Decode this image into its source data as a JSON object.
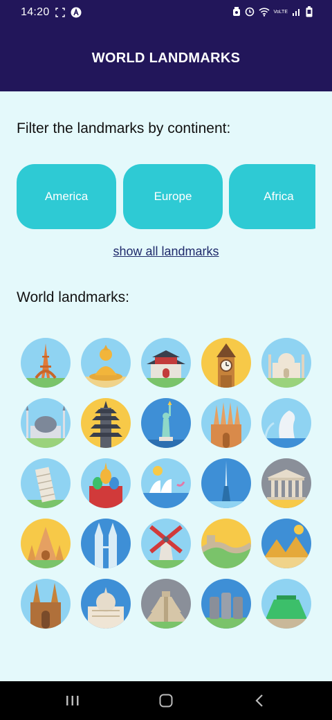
{
  "status_bar": {
    "time": "14:20",
    "left_icons": [
      "screenshot-icon",
      "app-notification-icon"
    ],
    "right_icons": [
      "alarm-icon",
      "clock-icon",
      "wifi-icon",
      "volte-icon",
      "signal-icon",
      "battery-icon"
    ],
    "network_label": "VoLTE"
  },
  "app_bar": {
    "title": "WORLD LANDMARKS"
  },
  "filter": {
    "heading": "Filter the landmarks by continent:",
    "chips": [
      {
        "label": "America"
      },
      {
        "label": "Europe"
      },
      {
        "label": "Africa"
      }
    ],
    "show_all_label": "show all landmarks"
  },
  "landmarks": {
    "heading": "World landmarks:",
    "items": [
      {
        "icon": "eiffel-tower-icon",
        "bg": "#8fd3f2"
      },
      {
        "icon": "buddha-statue-icon",
        "bg": "#8fd3f2"
      },
      {
        "icon": "chinese-gate-icon",
        "bg": "#8fd3f2"
      },
      {
        "icon": "big-ben-icon",
        "bg": "#f7c948"
      },
      {
        "icon": "taj-mahal-icon",
        "bg": "#8fd3f2"
      },
      {
        "icon": "blue-mosque-icon",
        "bg": "#8fd3f2"
      },
      {
        "icon": "pagoda-temple-icon",
        "bg": "#f7c948"
      },
      {
        "icon": "statue-of-liberty-icon",
        "bg": "#3e8fd6"
      },
      {
        "icon": "sagrada-familia-icon",
        "bg": "#8fd3f2"
      },
      {
        "icon": "merlion-icon",
        "bg": "#8fd3f2"
      },
      {
        "icon": "leaning-tower-pisa-icon",
        "bg": "#8fd3f2"
      },
      {
        "icon": "st-basils-cathedral-icon",
        "bg": "#8fd3f2"
      },
      {
        "icon": "sydney-opera-house-icon",
        "bg": "#8fd3f2"
      },
      {
        "icon": "burj-khalifa-icon",
        "bg": "#3e8fd6"
      },
      {
        "icon": "parthenon-icon",
        "bg": "#8a8f99"
      },
      {
        "icon": "angkor-wat-icon",
        "bg": "#f7c948"
      },
      {
        "icon": "petronas-towers-icon",
        "bg": "#3e8fd6"
      },
      {
        "icon": "windmill-icon",
        "bg": "#8fd3f2"
      },
      {
        "icon": "great-wall-icon",
        "bg": "#f7c948"
      },
      {
        "icon": "pyramids-icon",
        "bg": "#3e8fd6"
      },
      {
        "icon": "cologne-cathedral-icon",
        "bg": "#8fd3f2"
      },
      {
        "icon": "st-peters-basilica-icon",
        "bg": "#3e8fd6"
      },
      {
        "icon": "chichen-itza-icon",
        "bg": "#8a8f99"
      },
      {
        "icon": "moai-statues-icon",
        "bg": "#3e8fd6"
      },
      {
        "icon": "table-mountain-icon",
        "bg": "#8fd3f2"
      }
    ]
  },
  "nav_bar": {
    "buttons": [
      "recent-apps-icon",
      "home-icon",
      "back-icon"
    ]
  },
  "colors": {
    "header": "#22165a",
    "background": "#e4f9fb",
    "chip": "#2ecad4",
    "link": "#1f2a6b"
  }
}
